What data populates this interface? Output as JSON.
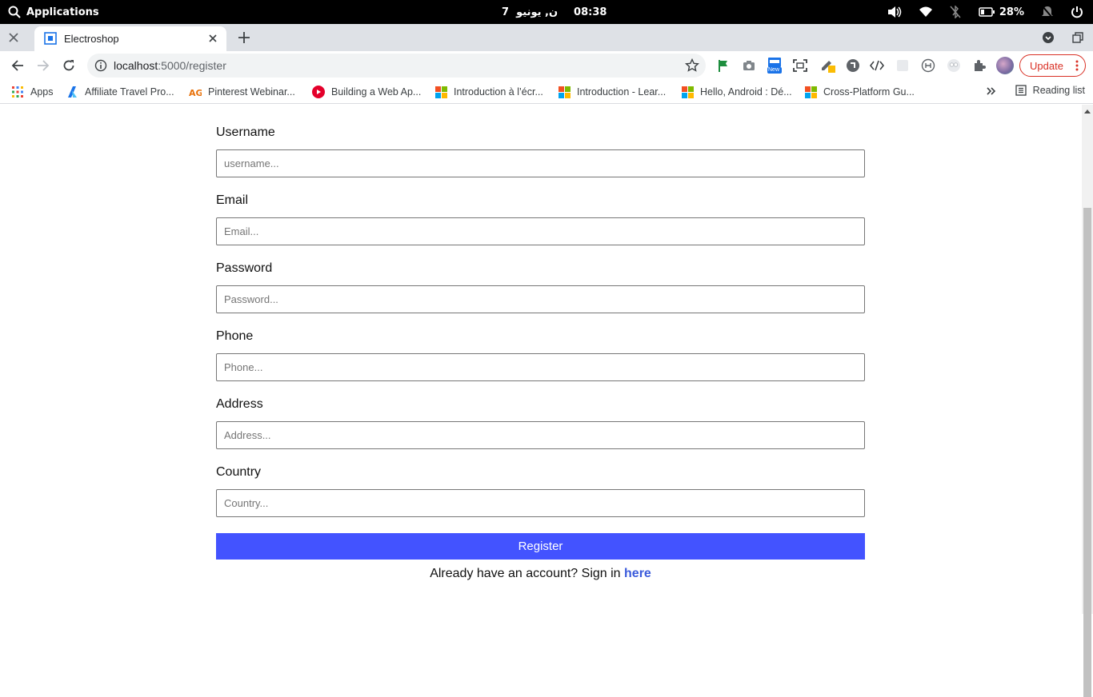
{
  "os_bar": {
    "applications_label": "Applications",
    "date": "7",
    "weekday_month": "ن, يونيو",
    "time": "08:38",
    "battery_percent": "28%"
  },
  "browser": {
    "tab": {
      "title": "Electroshop"
    },
    "url_host": "localhost",
    "url_path": ":5000/register",
    "new_badge": "New",
    "update_label": "Update",
    "reading_list_label": "Reading list",
    "bookmarks": [
      {
        "label": "Apps",
        "icon": "apps-grid-icon"
      },
      {
        "label": "Affiliate Travel Pro...",
        "icon": "affiliate-icon"
      },
      {
        "label": "Pinterest Webinar...",
        "icon": "ag-icon"
      },
      {
        "label": "Building a Web Ap...",
        "icon": "red-play-icon"
      },
      {
        "label": "Introduction à l’écr...",
        "icon": "microsoft-icon"
      },
      {
        "label": "Introduction - Lear...",
        "icon": "microsoft-icon"
      },
      {
        "label": "Hello, Android : Dé...",
        "icon": "microsoft-icon"
      },
      {
        "label": "Cross-Platform Gu...",
        "icon": "microsoft-icon"
      }
    ]
  },
  "form": {
    "fields": [
      {
        "label": "Username",
        "placeholder": "username..."
      },
      {
        "label": "Email",
        "placeholder": "Email..."
      },
      {
        "label": "Password",
        "placeholder": "Password..."
      },
      {
        "label": "Phone",
        "placeholder": "Phone..."
      },
      {
        "label": "Address",
        "placeholder": "Address..."
      },
      {
        "label": "Country",
        "placeholder": "Country..."
      }
    ],
    "submit_label": "Register",
    "signin_prompt": "Already have an account? Sign in ",
    "signin_link": "here",
    "button_color": "#4353ff",
    "link_color": "#3b5bdb"
  }
}
